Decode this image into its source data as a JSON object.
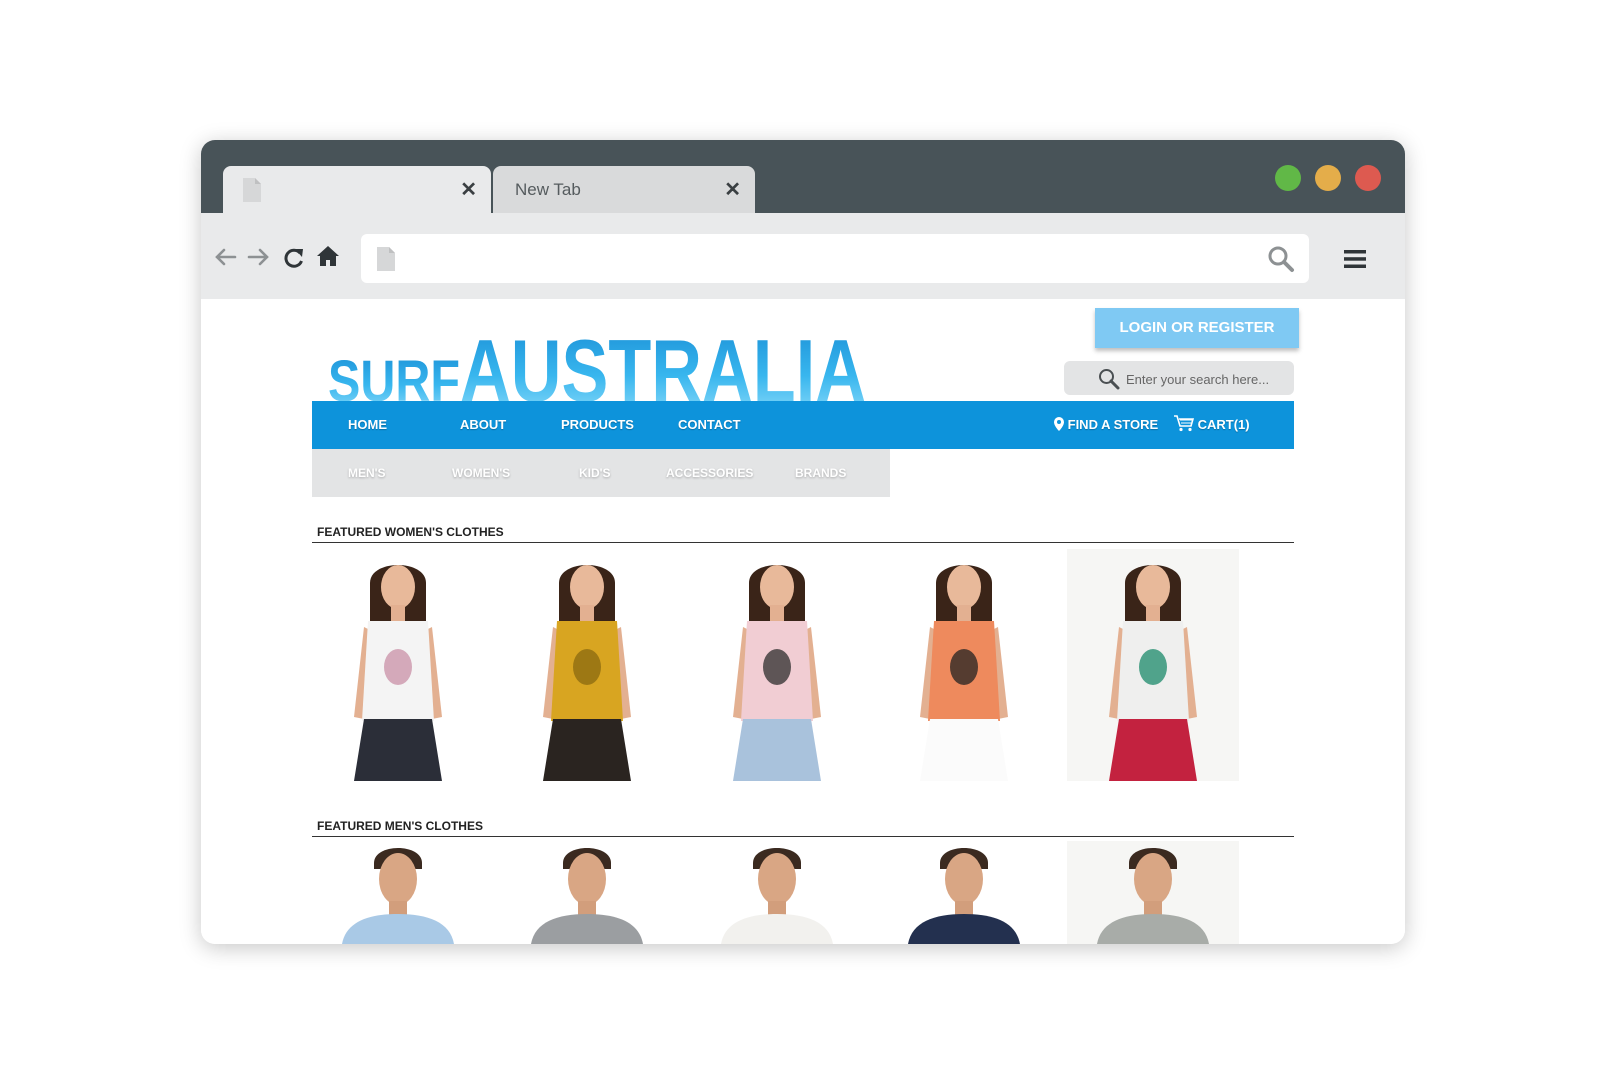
{
  "browser": {
    "tabs": [
      {
        "title": ""
      },
      {
        "title": "New Tab"
      }
    ],
    "address_bar": {
      "value": "",
      "placeholder": ""
    }
  },
  "site": {
    "logo": {
      "part1": "SURF",
      "part2": "AUSTRALIA"
    },
    "login_label": "LOGIN OR REGISTER",
    "search_placeholder": "Enter your search here...",
    "main_nav": [
      "HOME",
      "ABOUT",
      "PRODUCTS",
      "CONTACT"
    ],
    "find_store": "FIND A STORE",
    "cart": "CART(1)",
    "sub_nav": [
      "MEN'S",
      "WOMEN'S",
      "KID'S",
      "ACCESSORIES",
      "BRANDS"
    ],
    "sections": {
      "women": "FEATURED WOMEN'S CLOTHES",
      "men": "FEATURED MEN'S CLOTHES"
    },
    "women_products": [
      {
        "top": "#f4f4f4",
        "bottom": "#2b2e38",
        "accent": "#c990a7"
      },
      {
        "top": "#d8a521",
        "bottom": "#2a2420",
        "accent": "#8a6a10"
      },
      {
        "top": "#f1cdd3",
        "bottom": "#a9c2dc",
        "accent": "#2c2c2c"
      },
      {
        "top": "#ee8a5d",
        "bottom": "#fbfbfb",
        "accent": "#222222"
      },
      {
        "top": "#efefee",
        "bottom": "#c3223f",
        "accent": "#1b8a6a"
      }
    ],
    "men_products": [
      {
        "shirt": "#a9c9e6"
      },
      {
        "shirt": "#9b9ea1"
      },
      {
        "shirt": "#f2f1ee"
      },
      {
        "shirt": "#23304f"
      },
      {
        "shirt": "#a8aca8"
      }
    ]
  },
  "colors": {
    "titlebar": "#485358",
    "accent_blue": "#0d93db",
    "login_blue": "#7fc9f3"
  }
}
